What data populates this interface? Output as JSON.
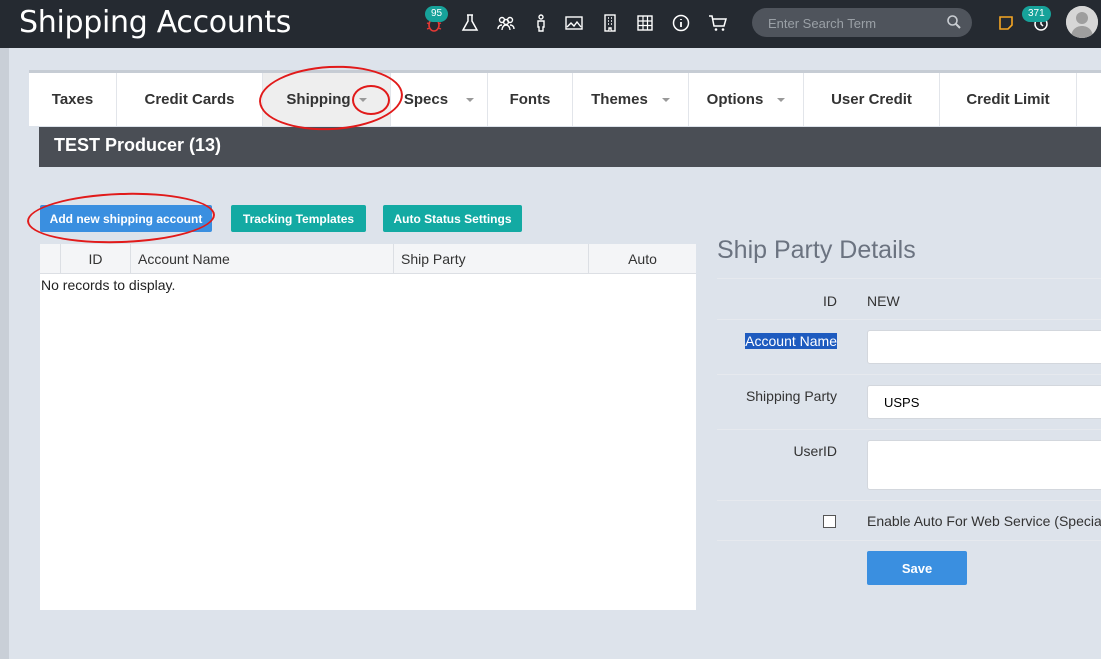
{
  "topbar": {
    "title": "Shipping Accounts",
    "icons": [
      {
        "name": "bug-icon",
        "badge": "95"
      },
      {
        "name": "flask-icon"
      },
      {
        "name": "people-icon"
      },
      {
        "name": "person-icon"
      },
      {
        "name": "image-icon"
      },
      {
        "name": "building-icon"
      },
      {
        "name": "table-icon"
      },
      {
        "name": "info-icon"
      },
      {
        "name": "cart-icon"
      }
    ],
    "search_placeholder": "Enter Search Term",
    "notes_icon": "sticky-note-icon",
    "history_badge": "371",
    "accent": "#17a29a"
  },
  "tabs": [
    {
      "label": "Taxes"
    },
    {
      "label": "Credit Cards"
    },
    {
      "label": "Shipping"
    },
    {
      "label": "Specs"
    },
    {
      "label": "Fonts"
    },
    {
      "label": "Themes"
    },
    {
      "label": "Options"
    },
    {
      "label": "User Credit"
    },
    {
      "label": "Credit Limit"
    }
  ],
  "producer": "TEST Producer (13)",
  "buttons": {
    "add": "Add new shipping account",
    "tracking": "Tracking Templates",
    "auto_status": "Auto Status Settings"
  },
  "grid": {
    "columns": [
      "ID",
      "Account Name",
      "Ship Party",
      "Auto"
    ],
    "empty_message": "No records to display."
  },
  "details": {
    "title": "Ship Party Details",
    "id_label": "ID",
    "id_value": "NEW",
    "account_name_label": "Account Name",
    "account_name_value": "",
    "shipping_party_label": "Shipping Party",
    "shipping_party_value": "USPS",
    "userid_label": "UserID",
    "userid_value": "",
    "enable_auto_label": "Enable Auto For Web Service (Special",
    "save_label": "Save"
  }
}
